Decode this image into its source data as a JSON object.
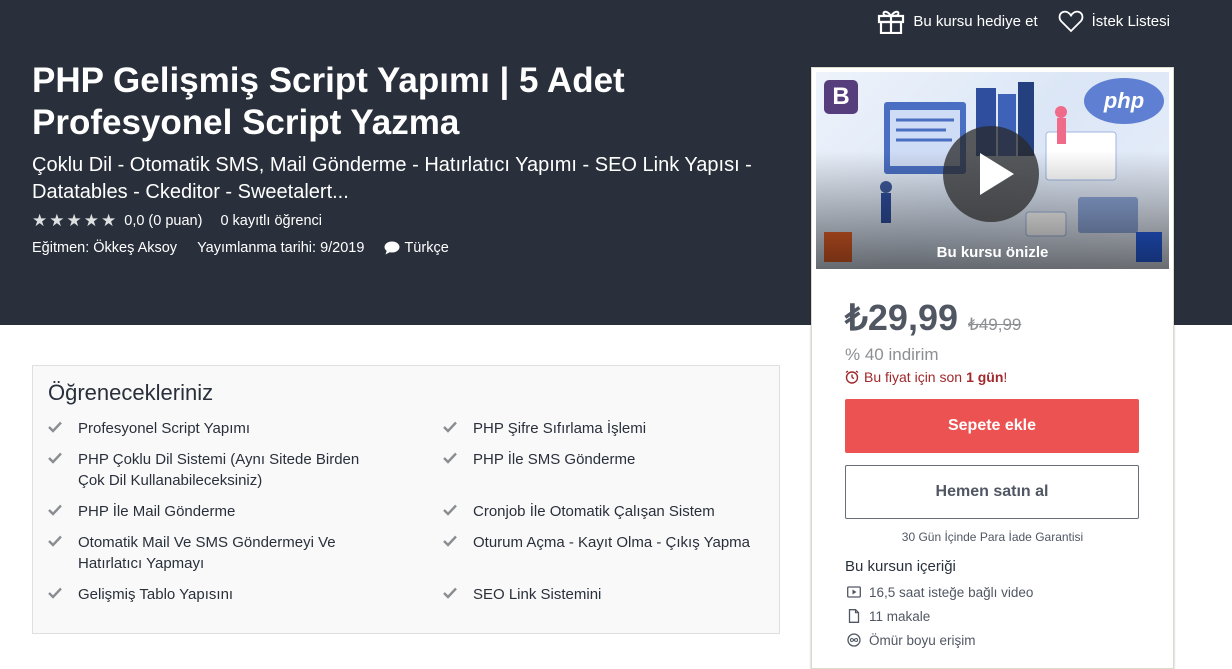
{
  "header": {
    "gift_label": "Bu kursu hediye et",
    "wishlist_label": "İstek Listesi"
  },
  "course": {
    "title": "PHP Gelişmiş Script Yapımı | 5 Adet Profesyonel Script Yazma",
    "subtitle": "Çoklu Dil - Otomatik SMS, Mail Gönderme - Hatırlatıcı Yapımı - SEO Link Yapısı - Datatables - Ckeditor - Sweetalert...",
    "rating_value": "0,0 (0 puan)",
    "star_rating": 0,
    "enrolled": "0 kayıtlı öğrenci",
    "instructor": "Eğitmen: Ökkeş Aksoy",
    "published": "Yayımlanma tarihi: 9/2019",
    "language": "Türkçe"
  },
  "sidebar": {
    "preview_label": "Bu kursu önizle",
    "badge_bootstrap": "B",
    "badge_php": "php",
    "price_current": "₺29,99",
    "price_original": "₺49,99",
    "discount": "% 40 indirim",
    "timer_prefix": "Bu fiyat için son",
    "timer_bold": "1 gün",
    "timer_suffix": "!",
    "add_to_cart": "Sepete ekle",
    "buy_now": "Hemen satın al",
    "guarantee": "30 Gün İçinde Para İade Garantisi",
    "includes_title": "Bu kursun içeriği",
    "includes": [
      {
        "icon": "video-icon",
        "label": "16,5 saat isteğe bağlı video"
      },
      {
        "icon": "article-icon",
        "label": "11 makale"
      },
      {
        "icon": "infinity-icon",
        "label": "Ömür boyu erişim"
      }
    ]
  },
  "learn": {
    "title": "Öğrenecekleriniz",
    "items": [
      "Profesyonel Script Yapımı",
      "PHP Şifre Sıfırlama İşlemi",
      "PHP Çoklu Dil Sistemi (Aynı Sitede Birden Çok Dil Kullanabileceksiniz)",
      "PHP İle SMS Gönderme",
      "PHP İle Mail Gönderme",
      "Cronjob İle Otomatik Çalışan Sistem",
      "Otomatik Mail Ve SMS Göndermeyi Ve Hatırlatıcı Yapmayı",
      "Oturum Açma - Kayıt Olma - Çıkış Yapma",
      "Gelişmiş Tablo Yapısını",
      "SEO Link Sistemini"
    ]
  },
  "colors": {
    "hero_bg": "#29303b",
    "cart_button": "#ec5252",
    "timer_text": "#a1282d"
  }
}
